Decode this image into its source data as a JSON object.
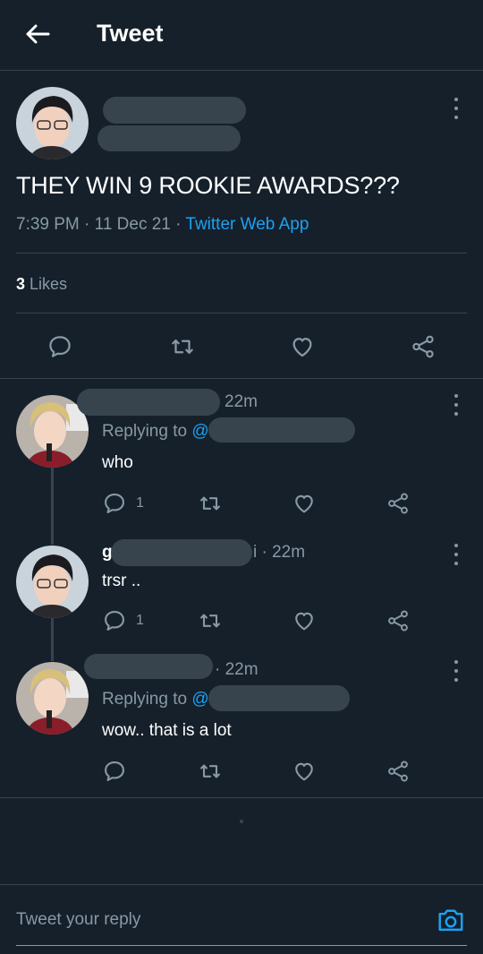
{
  "header": {
    "title": "Tweet"
  },
  "tweet": {
    "text": "THEY WIN 9 ROOKIE AWARDS???",
    "time": "7:39 PM",
    "sep1": "·",
    "date": "11 Dec 21",
    "sep2": "·",
    "source": "Twitter Web App",
    "likes_count": "3",
    "likes_label": "Likes"
  },
  "replies": [
    {
      "handle_prefix": "",
      "time": "22m",
      "replying_label": "Replying to",
      "replying_at": "@",
      "text": "who",
      "reply_count": "1"
    },
    {
      "handle_prefix": "g",
      "handle_suffix": "i · 22m",
      "text": "trsr ..",
      "reply_count": "1"
    },
    {
      "handle_prefix": "",
      "time": "· 22m",
      "replying_label": "Replying to",
      "replying_at": "@",
      "text": "wow.. that is a lot",
      "reply_count": ""
    }
  ],
  "composer": {
    "placeholder": "Tweet your reply"
  },
  "colors": {
    "background": "#15202b",
    "accent": "#1da1f2",
    "muted": "#8899a6",
    "divider": "#38444d"
  }
}
